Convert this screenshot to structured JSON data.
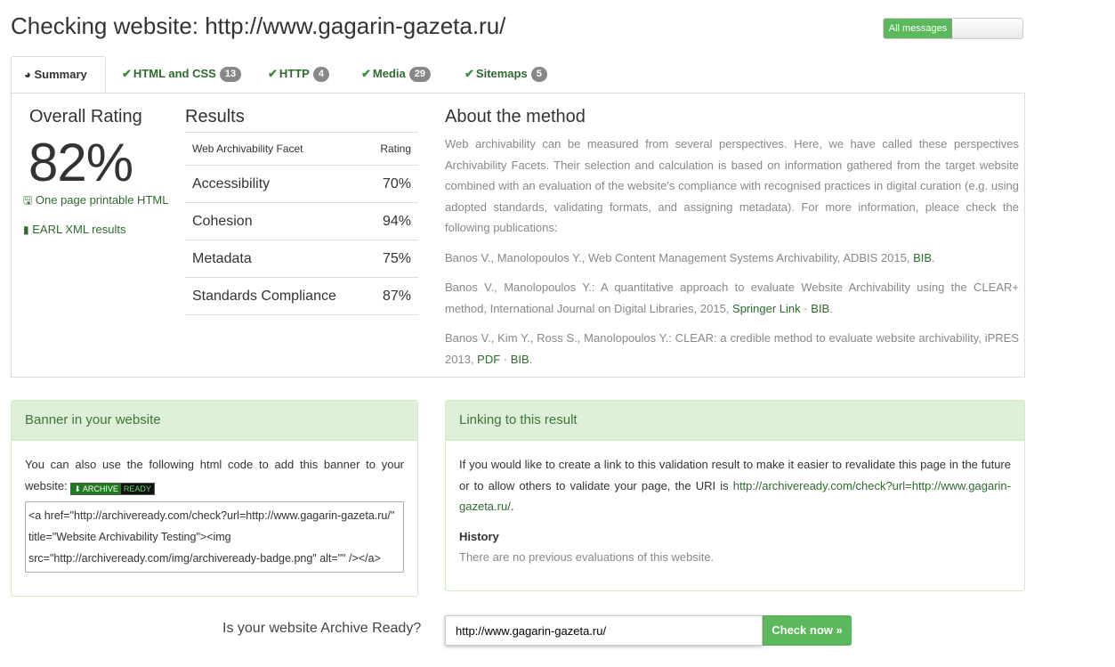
{
  "page_title": "Checking website: http://www.gagarin-gazeta.ru/",
  "toggle": {
    "label": "All messages"
  },
  "tabs": [
    {
      "icon": "dashboard-icon",
      "label": "Summary"
    },
    {
      "label": "HTML and CSS",
      "count": "13"
    },
    {
      "label": "HTTP",
      "count": "4"
    },
    {
      "label": "Media",
      "count": "29"
    },
    {
      "label": "Sitemaps",
      "count": "5"
    }
  ],
  "summary": {
    "overall_title": "Overall Rating",
    "overall_value": "82%",
    "links": {
      "printable": "One page printable HTML",
      "earl": "EARL XML results"
    },
    "results_title": "Results",
    "table": {
      "col_facet": "Web Archivability Facet",
      "col_rating": "Rating",
      "rows": [
        {
          "facet": "Accessibility",
          "rating": "70%"
        },
        {
          "facet": "Cohesion",
          "rating": "94%"
        },
        {
          "facet": "Metadata",
          "rating": "75%"
        },
        {
          "facet": "Standards Compliance",
          "rating": "87%"
        }
      ]
    },
    "about": {
      "title": "About the method",
      "intro": "Web archivability can be measured from several perspectives. Here, we have called these perspectives Archivability Facets. Their selection and calculation is based on information gathered from the target website combined with an evaluation of the website's compliance with recognised practices in digital curation (e.g. using adopted standards, validating formats, and assigning metadata). For more information, pleace check the following publications:",
      "ref1": "Banos V., Manolopoulos Y., Web Content Management Systems Archivability, ADBIS 2015, ",
      "ref1_bib": "BIB",
      "ref2": "Banos V., Manolopoulos Y.: A quantitative approach to evaluate Website Archivability using the CLEAR+ method, International Journal on Digital Libraries, 2015, ",
      "ref2_link": "Springer Link",
      "ref2_bib": "BIB",
      "ref3": "Banos V., Kim Y., Ross S., Manolopoulos Y.: CLEAR: a credible method to evaluate website archivability, iPRES 2013, ",
      "ref3_pdf": "PDF",
      "ref3_bib": "BIB",
      "sep": " · ",
      "dot": "."
    }
  },
  "banner": {
    "title": "Banner in your website",
    "text": "You can also use the following html code to add this banner to your website:",
    "badge_a": "ARCHIVE",
    "badge_b": "READY",
    "code": "<a href=\"http://archiveready.com/check?url=http://www.gagarin-gazeta.ru/\" title=\"Website Archivability Testing\"><img src=\"http://archiveready.com/img/archiveready-badge.png\" alt=\"\" /></a>"
  },
  "linking": {
    "title": "Linking to this result",
    "text": "If you would like to create a link to this validation result to make it easier to revalidate this page in the future or to allow others to validate your page, the URI is ",
    "uri": "http://archiveready.com/check?url=http://www.gagarin-gazeta.ru/",
    "history_title": "History",
    "history_text": "There are no previous evaluations of this website."
  },
  "footer": {
    "question": "Is your website Archive Ready?",
    "url_value": "http://www.gagarin-gazeta.ru/",
    "button": "Check now"
  },
  "colors": {
    "accent": "#5cb85c",
    "link": "#2e6a2e",
    "panel_head": "#dff0d8"
  }
}
